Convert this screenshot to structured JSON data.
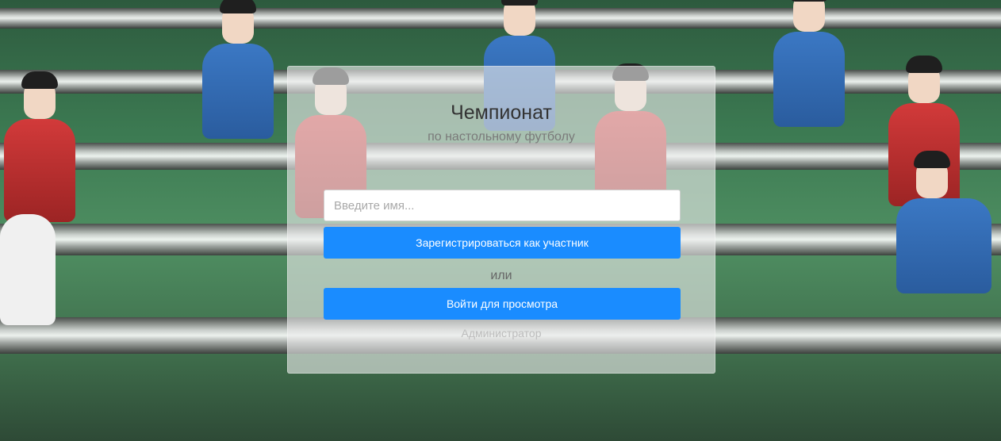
{
  "card": {
    "title": "Чемпионат",
    "subtitle": "по настольному футболу"
  },
  "form": {
    "name_placeholder": "Введите имя...",
    "name_value": "",
    "register_label": "Зарегистрироваться как участник",
    "or_label": "или",
    "login_label": "Войти для просмотра",
    "admin_label": "Администратор"
  },
  "colors": {
    "button": "#1a8cff",
    "card_background": "rgba(235,235,235,0.62)"
  },
  "background": {
    "scene": "foosball-table-photo"
  }
}
